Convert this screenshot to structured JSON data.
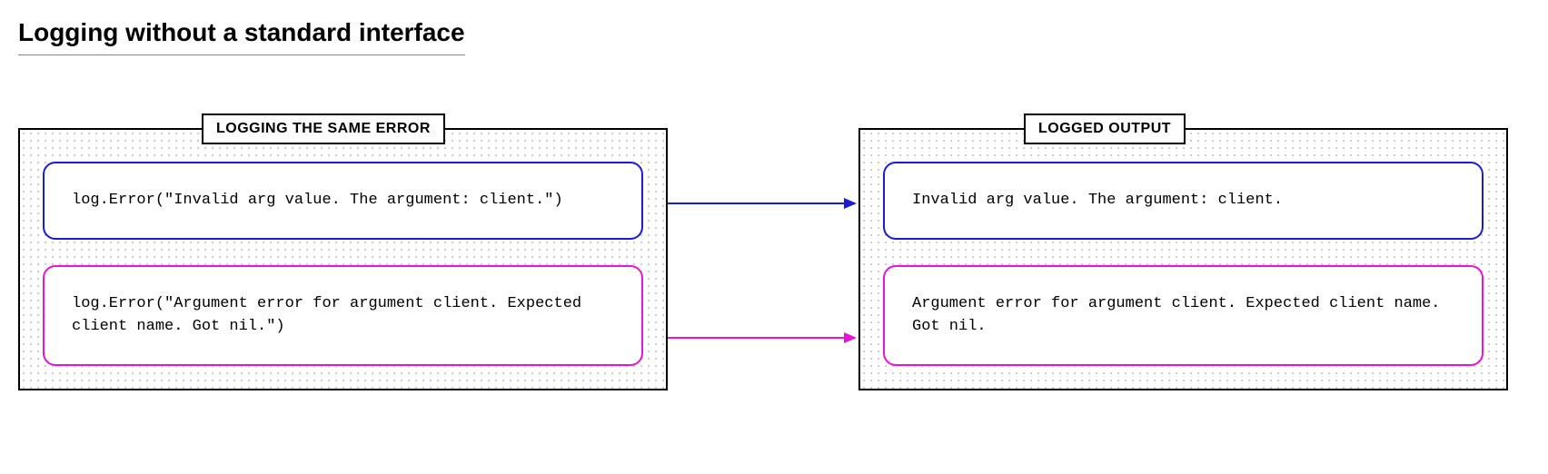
{
  "title": "Logging without a standard interface",
  "leftPanel": {
    "label": "LOGGING THE SAME ERROR",
    "boxes": [
      {
        "color": "blue",
        "code": "log.Error(\"Invalid arg value. The argument: client.\")"
      },
      {
        "color": "magenta",
        "code": "log.Error(\"Argument error for argument client. Expected client name. Got nil.\")"
      }
    ]
  },
  "rightPanel": {
    "label": "LOGGED OUTPUT",
    "boxes": [
      {
        "color": "blue",
        "text": "Invalid arg value. The argument: client."
      },
      {
        "color": "magenta",
        "text": "Argument error for argument client. Expected client name. Got nil."
      }
    ]
  },
  "arrows": [
    {
      "color": "blue"
    },
    {
      "color": "magenta"
    }
  ]
}
